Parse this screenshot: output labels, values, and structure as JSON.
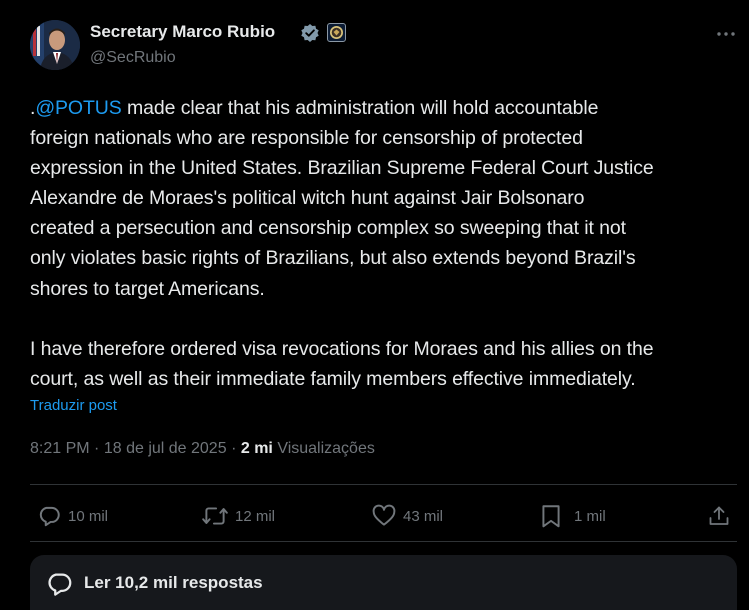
{
  "author": {
    "name": "Secretary Marco Rubio",
    "handle": "@SecRubio"
  },
  "post": {
    "mention": "@POTUS",
    "paragraph1_lines": [
      " made clear that his administration will hold accountable",
      "foreign nationals who are responsible for censorship of protected",
      "expression in the United States. Brazilian Supreme Federal Court Justice",
      "Alexandre de Moraes's political witch hunt against Jair Bolsonaro",
      "created a persecution and censorship complex so sweeping that it not",
      "only violates basic rights of Brazilians, but also extends beyond Brazil's",
      "shores to target Americans."
    ],
    "paragraph2_lines": [
      "I have therefore ordered visa revocations for Moraes and his allies on the",
      "court, as well as their immediate family members effective immediately."
    ],
    "translate_label": "Traduzir post"
  },
  "meta": {
    "time": "8:21 PM",
    "date": "18 de jul de 2025",
    "views_count": "2 mi",
    "views_label": "Visualizações"
  },
  "actions": {
    "replies": "10 mil",
    "reposts": "12 mil",
    "likes": "43 mil",
    "bookmarks": "1 mil"
  },
  "replies_button": {
    "label": "Ler 10,2 mil respostas"
  },
  "colors": {
    "background": "#000000",
    "text": "#e7e9ea",
    "muted": "#71767b",
    "accent": "#1d9bf0",
    "divider": "#2f3336"
  },
  "icons": {
    "verified": "verified-badge-icon",
    "org": "state-department-seal-icon",
    "more": "more-horizontal-icon",
    "reply": "reply-bubble-icon",
    "repost": "repost-arrows-icon",
    "like": "heart-icon",
    "bookmark": "bookmark-icon",
    "share": "share-icon"
  }
}
